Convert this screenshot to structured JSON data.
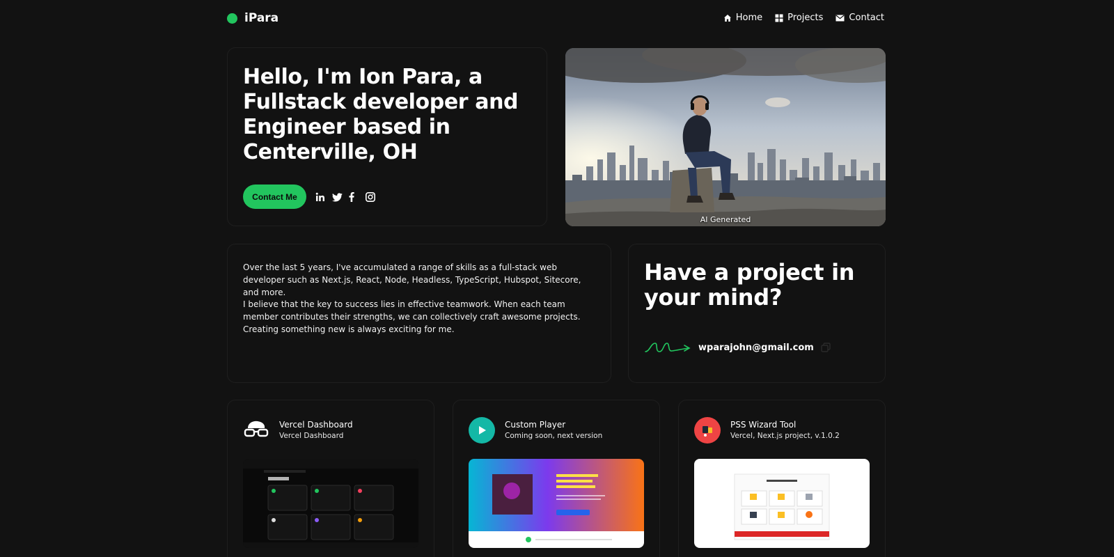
{
  "header": {
    "brand": "iPara",
    "nav": [
      {
        "label": "Home",
        "icon": "home-icon"
      },
      {
        "label": "Projects",
        "icon": "grid-icon"
      },
      {
        "label": "Contact",
        "icon": "mail-icon"
      }
    ]
  },
  "hero": {
    "title": "Hello, I'm Ion Para, a Fullstack developer and Engineer based in Centerville, OH",
    "cta_label": "Contact Me",
    "socials": [
      "linkedin-icon",
      "twitter-icon",
      "facebook-icon",
      "instagram-icon"
    ],
    "image_caption": "AI Generated"
  },
  "about": {
    "paragraph1": "Over the last 5 years, I've accumulated a range of skills as a full-stack web developer such as Next.js, React, Node, Headless, TypeScript, Hubspot, Sitecore, and more.",
    "paragraph2": "I believe that the key to success lies in effective teamwork. When each team member contributes their strengths, we can collectively craft awesome projects. Creating something new is always exciting for me."
  },
  "project_cta": {
    "title": "Have a project in your mind?",
    "email": "wparajohn@gmail.com"
  },
  "projects": [
    {
      "title": "Vercel Dashboard",
      "subtitle": "Vercel Dashboard"
    },
    {
      "title": "Custom Player",
      "subtitle": "Coming soon, next version"
    },
    {
      "title": "PSS Wizard Tool",
      "subtitle": "Vercel, Next.js project, v.1.0.2"
    }
  ],
  "colors": {
    "accent": "#22c55e",
    "background": "#121212"
  }
}
